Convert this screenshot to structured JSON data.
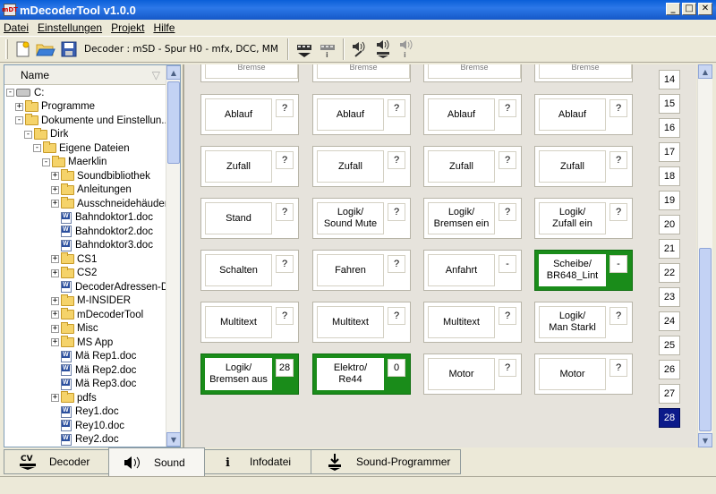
{
  "window": {
    "title": "mDecoderTool v1.0.0",
    "icon_text": "mDT",
    "minimize": "_",
    "maximize": "□",
    "close": "✕"
  },
  "menu": [
    "Datei",
    "Einstellungen",
    "Projekt",
    "Hilfe"
  ],
  "toolbar": {
    "decoder_label": "Decoder : mSD - Spur H0 - mfx, DCC, MM"
  },
  "tree": {
    "header": "Name",
    "scroll_up": "▲",
    "scroll_down": "▼",
    "items": [
      {
        "label": "C:",
        "indent": 0,
        "kind": "drive",
        "exp": "-"
      },
      {
        "label": "Programme",
        "indent": 1,
        "kind": "folder",
        "exp": "+"
      },
      {
        "label": "Dokumente und Einstellun...",
        "indent": 1,
        "kind": "folder",
        "exp": "-"
      },
      {
        "label": "Dirk",
        "indent": 2,
        "kind": "folder",
        "exp": "-"
      },
      {
        "label": "Eigene Dateien",
        "indent": 3,
        "kind": "folder",
        "exp": "-"
      },
      {
        "label": "Maerklin",
        "indent": 4,
        "kind": "folder",
        "exp": "-"
      },
      {
        "label": "Soundbibliothek",
        "indent": 5,
        "kind": "folder",
        "exp": "+"
      },
      {
        "label": "Anleitungen",
        "indent": 5,
        "kind": "folder",
        "exp": "+"
      },
      {
        "label": "Ausschneidehäuder",
        "indent": 5,
        "kind": "folder",
        "exp": "+"
      },
      {
        "label": "Bahndoktor1.doc",
        "indent": 5,
        "kind": "doc",
        "exp": ""
      },
      {
        "label": "Bahndoktor2.doc",
        "indent": 5,
        "kind": "doc",
        "exp": ""
      },
      {
        "label": "Bahndoktor3.doc",
        "indent": 5,
        "kind": "doc",
        "exp": ""
      },
      {
        "label": "CS1",
        "indent": 5,
        "kind": "folder",
        "exp": "+"
      },
      {
        "label": "CS2",
        "indent": 5,
        "kind": "folder",
        "exp": "+"
      },
      {
        "label": "DecoderAdressen-DI...",
        "indent": 5,
        "kind": "doc",
        "exp": ""
      },
      {
        "label": "M-INSIDER",
        "indent": 5,
        "kind": "folder",
        "exp": "+"
      },
      {
        "label": "mDecoderTool",
        "indent": 5,
        "kind": "folder",
        "exp": "+"
      },
      {
        "label": "Misc",
        "indent": 5,
        "kind": "folder",
        "exp": "+"
      },
      {
        "label": "MS App",
        "indent": 5,
        "kind": "folder",
        "exp": "+"
      },
      {
        "label": "Mä Rep1.doc",
        "indent": 5,
        "kind": "doc",
        "exp": ""
      },
      {
        "label": "Mä Rep2.doc",
        "indent": 5,
        "kind": "doc",
        "exp": ""
      },
      {
        "label": "Mä Rep3.doc",
        "indent": 5,
        "kind": "doc",
        "exp": ""
      },
      {
        "label": "pdfs",
        "indent": 5,
        "kind": "folder",
        "exp": "+"
      },
      {
        "label": "Rey1.doc",
        "indent": 5,
        "kind": "doc",
        "exp": ""
      },
      {
        "label": "Rey10.doc",
        "indent": 5,
        "kind": "doc",
        "exp": ""
      },
      {
        "label": "Rey2.doc",
        "indent": 5,
        "kind": "doc",
        "exp": ""
      }
    ]
  },
  "sound_grid": {
    "partial_labels": [
      "Bremse",
      "Bremse",
      "Bremse",
      "Bremse"
    ],
    "rows": [
      [
        {
          "label": "Ablauf",
          "value": "?",
          "active": false
        },
        {
          "label": "Ablauf",
          "value": "?",
          "active": false
        },
        {
          "label": "Ablauf",
          "value": "?",
          "active": false
        },
        {
          "label": "Ablauf",
          "value": "?",
          "active": false
        }
      ],
      [
        {
          "label": "Zufall",
          "value": "?",
          "active": false
        },
        {
          "label": "Zufall",
          "value": "?",
          "active": false
        },
        {
          "label": "Zufall",
          "value": "?",
          "active": false
        },
        {
          "label": "Zufall",
          "value": "?",
          "active": false
        }
      ],
      [
        {
          "label": "Stand",
          "value": "?",
          "active": false
        },
        {
          "label": "Logik/\nSound Mute",
          "value": "?",
          "active": false
        },
        {
          "label": "Logik/\nBremsen ein",
          "value": "?",
          "active": false
        },
        {
          "label": "Logik/\nZufall ein",
          "value": "?",
          "active": false
        }
      ],
      [
        {
          "label": "Schalten",
          "value": "?",
          "active": false
        },
        {
          "label": "Fahren",
          "value": "?",
          "active": false
        },
        {
          "label": "Anfahrt",
          "value": "-",
          "active": false
        },
        {
          "label": "Scheibe/\nBR648_Lint",
          "value": "-",
          "active": true
        }
      ],
      [
        {
          "label": "Multitext",
          "value": "?",
          "active": false
        },
        {
          "label": "Multitext",
          "value": "?",
          "active": false
        },
        {
          "label": "Multitext",
          "value": "?",
          "active": false
        },
        {
          "label": "Logik/\nMan Starkl",
          "value": "?",
          "active": false
        }
      ],
      [
        {
          "label": "Logik/\nBremsen aus",
          "value": "28",
          "active": true
        },
        {
          "label": "Elektro/\nRe44",
          "value": "0",
          "active": true
        },
        {
          "label": "Motor",
          "value": "?",
          "active": false
        },
        {
          "label": "Motor",
          "value": "?",
          "active": false
        }
      ]
    ]
  },
  "numbers": {
    "items": [
      "14",
      "15",
      "16",
      "17",
      "18",
      "19",
      "20",
      "21",
      "22",
      "23",
      "24",
      "25",
      "26",
      "27",
      "28"
    ],
    "selected": "28"
  },
  "main_scroll": {
    "up": "▲",
    "down": "▼"
  },
  "tabs": [
    {
      "label": "Decoder",
      "icon": "CV",
      "active": false
    },
    {
      "label": "Sound",
      "icon": "speaker",
      "active": true
    },
    {
      "label": "Infodatei",
      "icon": "i",
      "active": false
    },
    {
      "label": "Sound-Programmer",
      "icon": "download",
      "active": false
    }
  ],
  "colors": {
    "active_green": "#1a8c1a",
    "selected_blue": "#0b1a8a",
    "titlebar": "#0a5fd8"
  }
}
